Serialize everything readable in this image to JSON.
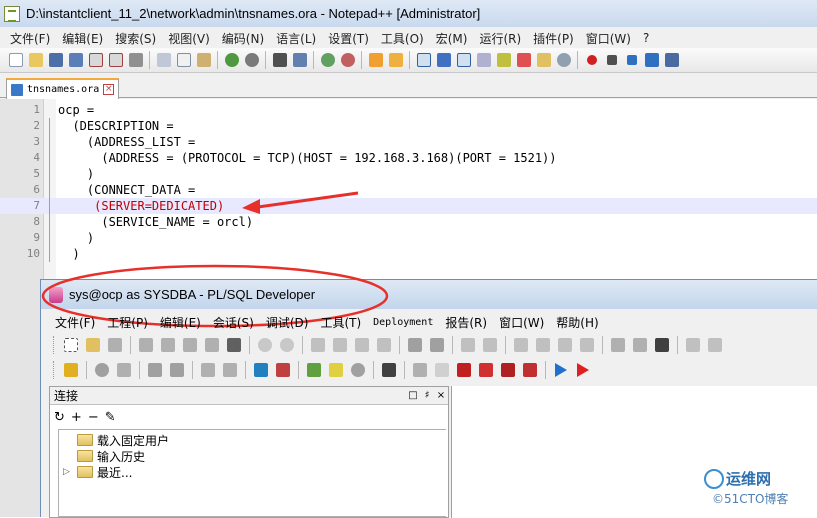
{
  "npp": {
    "title": "D:\\instantclient_11_2\\network\\admin\\tnsnames.ora - Notepad++ [Administrator]",
    "menu": [
      "文件(F)",
      "编辑(E)",
      "搜索(S)",
      "视图(V)",
      "编码(N)",
      "语言(L)",
      "设置(T)",
      "工具(O)",
      "宏(M)",
      "运行(R)",
      "插件(P)",
      "窗口(W)",
      "?"
    ],
    "tab_label": "tnsnames.ora",
    "lines": [
      {
        "no": "1",
        "text": "ocp ="
      },
      {
        "no": "2",
        "text": "  (DESCRIPTION ="
      },
      {
        "no": "3",
        "text": "    (ADDRESS_LIST ="
      },
      {
        "no": "4",
        "text": "      (ADDRESS = (PROTOCOL = TCP)(HOST = 192.168.3.168)(PORT = 1521))"
      },
      {
        "no": "5",
        "text": "    )"
      },
      {
        "no": "6",
        "text": "    (CONNECT_DATA ="
      },
      {
        "no": "7",
        "text": "     (SERVER=DEDICATED)"
      },
      {
        "no": "8",
        "text": "      (SERVICE_NAME = orcl)"
      },
      {
        "no": "9",
        "text": "    )"
      },
      {
        "no": "10",
        "text": "  )"
      }
    ]
  },
  "plsql": {
    "title": "sys@ocp as SYSDBA - PL/SQL Developer",
    "menu": [
      "文件(F)",
      "工程(P)",
      "编辑(E)",
      "会话(S)",
      "调试(D)",
      "工具(T)",
      "Deployment",
      "报告(R)",
      "窗口(W)",
      "帮助(H)"
    ],
    "conn_panel_title": "连接",
    "tree_items": [
      "载入固定用户",
      "输入历史",
      "最近..."
    ]
  },
  "watermark": {
    "line1": "运维网",
    "line2": "©51CTO博客"
  },
  "colors": {
    "annotation_red": "#e8302a",
    "current_line": "#e8e8ff"
  }
}
